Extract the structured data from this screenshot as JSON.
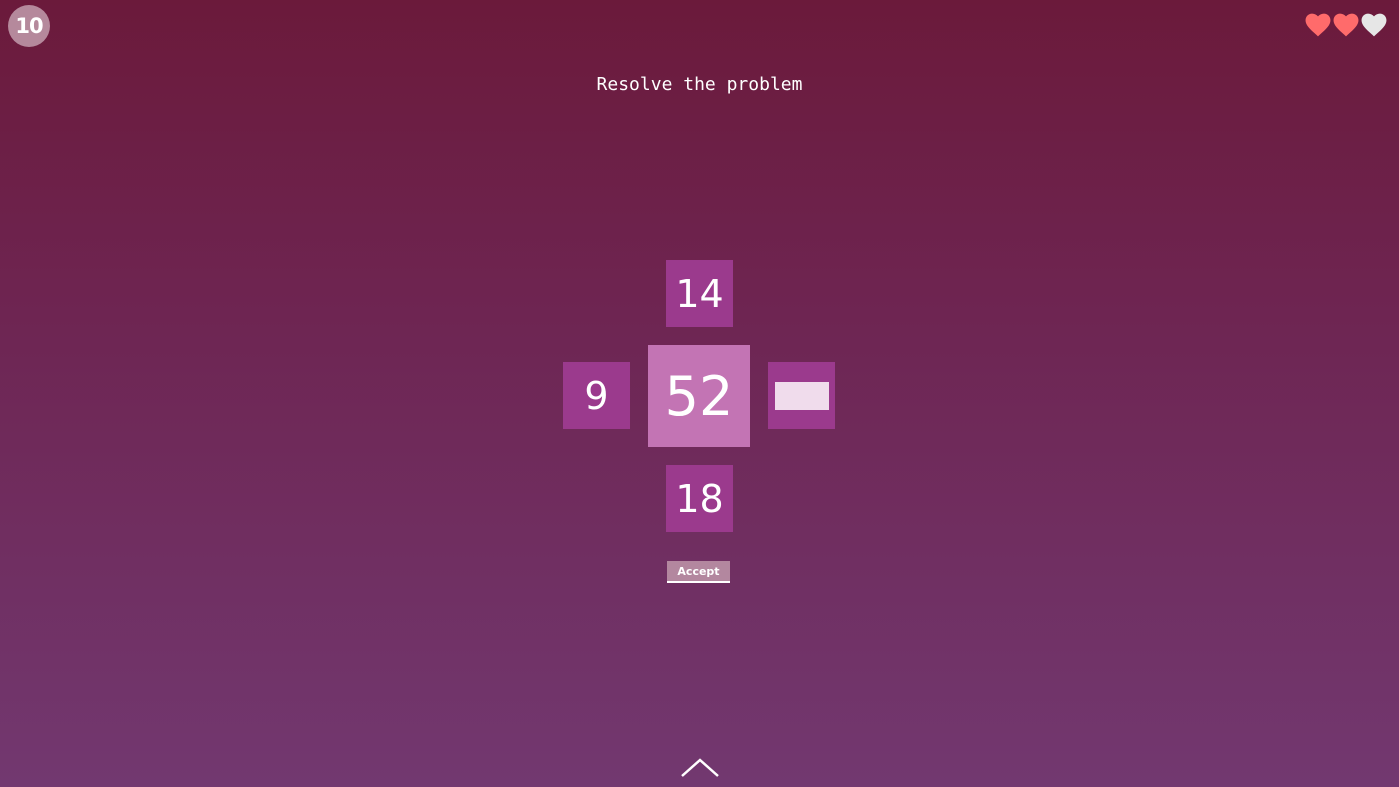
{
  "level": {
    "number": "10"
  },
  "lives": {
    "total": 3,
    "remaining": 2,
    "full_color": "#ff6b6b",
    "empty_color": "#e6e6e6"
  },
  "prompt": {
    "title": "Resolve the problem"
  },
  "puzzle": {
    "top": "14",
    "left": "9",
    "center": "52",
    "bottom": "18",
    "right_value": ""
  },
  "actions": {
    "accept_label": "Accept"
  },
  "colors": {
    "tile": "#9b3a8d",
    "center_tile": "#c374b4",
    "input": "#f0dcec"
  },
  "icons": {
    "expand": "chevron-up-icon",
    "life": "heart-icon"
  }
}
